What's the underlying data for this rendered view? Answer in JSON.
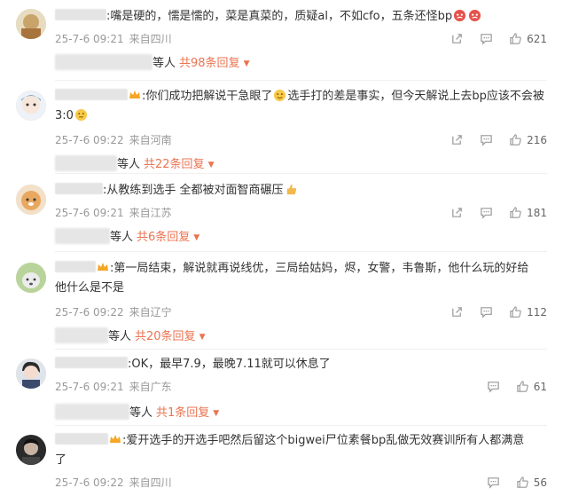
{
  "comments": [
    {
      "text": ":嘴是硬的，懦是懦的，菜是真菜的，质疑al，不如cfo，五条还怪bp",
      "date": "25-7-6 09:21",
      "location": "来自四川",
      "likes": "621",
      "replies_suffix": "等人",
      "replies_total": "共98条回复"
    },
    {
      "text_a": ":你们成功把解说干急眼了",
      "text_b": "选手打的差是事实，但今天解说上去bp应该不会被",
      "text_c": "3:0",
      "date": "25-7-6 09:22",
      "location": "来自河南",
      "likes": "216",
      "replies_suffix": "等人",
      "replies_total": "共22条回复"
    },
    {
      "text": ":从教练到选手 全都被对面智商碾压",
      "date": "25-7-6 09:21",
      "location": "来自江苏",
      "likes": "181",
      "replies_suffix": "等人",
      "replies_total": "共6条回复"
    },
    {
      "text_a": ":第一局结束，解说就再说线优，三局给姑妈，烬，女警，韦鲁斯，他什么玩的好给",
      "text_b": "他什么是不是",
      "date": "25-7-6 09:22",
      "location": "来自辽宁",
      "likes": "112",
      "replies_suffix": "等人",
      "replies_total": "共20条回复"
    },
    {
      "text": ":OK，最早7.9，最晚7.11就可以休息了",
      "date": "25-7-6 09:21",
      "location": "来自广东",
      "likes": "61",
      "replies_suffix": "等人",
      "replies_total": "共1条回复"
    },
    {
      "text_a": ":爱开选手的开选手吧然后留这个bigwei尸位素餐bp乱做无效赛训所有人都满意",
      "text_b": "了",
      "date": "25-7-6 09:22",
      "location": "来自四川",
      "likes": "56"
    }
  ],
  "icons": {
    "share": "share-icon",
    "comment": "comment-icon",
    "like": "thumbs-up-icon",
    "expand": "chevron-down-icon"
  },
  "colors": {
    "accent": "#eb7350",
    "meta": "#999999",
    "text": "#333333"
  }
}
